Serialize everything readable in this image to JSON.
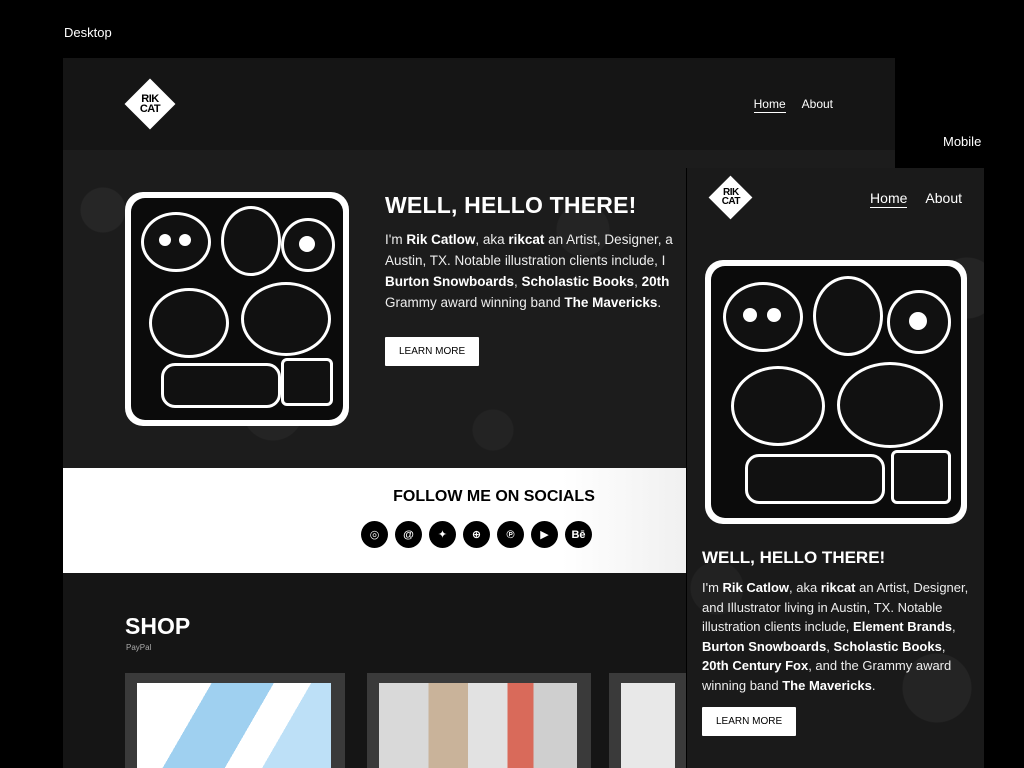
{
  "labels": {
    "desktop": "Desktop",
    "mobile": "Mobile"
  },
  "brand": {
    "logo_line1": "RIK",
    "logo_line2": "CAT"
  },
  "nav": {
    "home": "Home",
    "about": "About"
  },
  "hero": {
    "title": "WELL, HELLO THERE!",
    "intro_1": "I'm ",
    "name": "Rik Catlow",
    "intro_2": ", aka ",
    "alias": "rikcat",
    "intro_3": " an Artist, Designer, and Illustrator living in Austin, TX. Notable illustration clients include, ",
    "client_1": "Element Brands",
    "sep_1": ", ",
    "client_2": "Burton Snowboards",
    "sep_2": ", ",
    "client_3": "Scholastic Books",
    "sep_3": ", ",
    "client_4": "20th Century Fox",
    "intro_4": ", and the Grammy award winning band ",
    "band": "The Mavericks",
    "end": ".",
    "desktop_line1_a": "I'm ",
    "desktop_line1_b": ", aka ",
    "desktop_line1_c": " an Artist, Designer, a",
    "desktop_line2": "Austin, TX. Notable illustration clients include, I",
    "desktop_line3_c": "20th",
    "desktop_line4_a": "Grammy award winning band ",
    "cta": "LEARN MORE"
  },
  "socials": {
    "title": "FOLLOW ME ON SOCIALS",
    "icons": [
      "instagram-icon",
      "threads-icon",
      "bluesky-icon",
      "dribbble-icon",
      "pinterest-icon",
      "youtube-icon",
      "behance-icon"
    ],
    "glyphs": [
      "◎",
      "@",
      "✦",
      "⊕",
      "℗",
      "▶",
      "Bē"
    ]
  },
  "shop": {
    "title": "SHOP",
    "subtitle": "PayPal"
  },
  "colors": {
    "background": "#000000",
    "panel": "#151515",
    "accent": "#ffffff"
  }
}
